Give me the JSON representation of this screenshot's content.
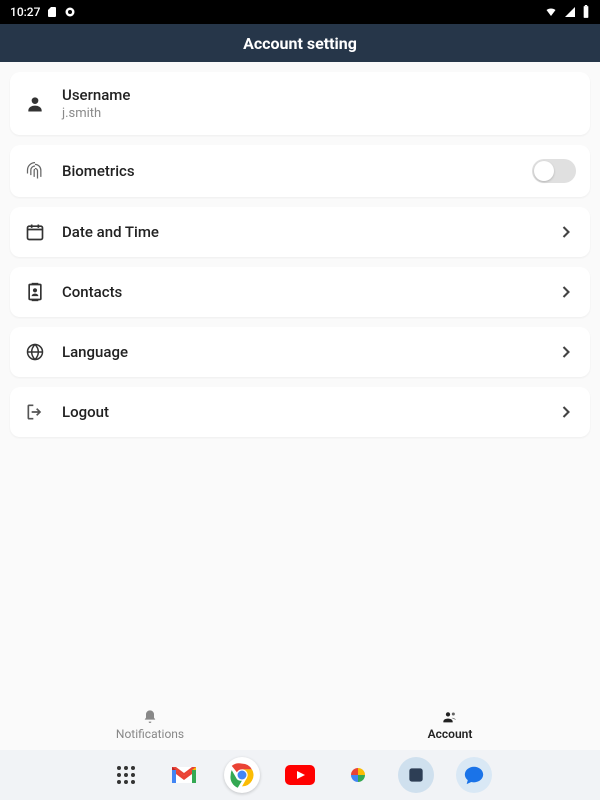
{
  "statusBar": {
    "time": "10:27"
  },
  "header": {
    "title": "Account setting"
  },
  "settings": {
    "username": {
      "label": "Username",
      "value": "j.smith"
    },
    "biometrics": {
      "label": "Biometrics",
      "enabled": false
    },
    "dateTime": {
      "label": "Date and Time"
    },
    "contacts": {
      "label": "Contacts"
    },
    "language": {
      "label": "Language"
    },
    "logout": {
      "label": "Logout"
    }
  },
  "bottomTabs": {
    "notifications": {
      "label": "Notifications"
    },
    "account": {
      "label": "Account"
    }
  }
}
